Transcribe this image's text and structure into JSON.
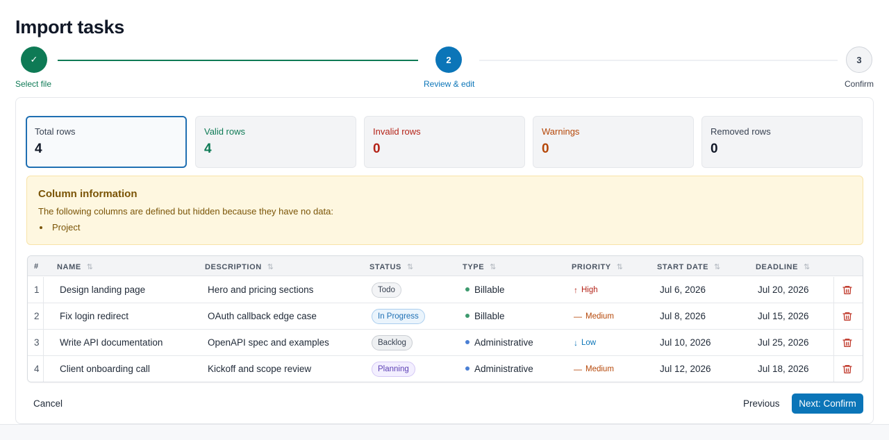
{
  "page": {
    "title": "Import tasks"
  },
  "stepper": {
    "steps": [
      {
        "marker": "✓",
        "label": "Select file",
        "state": "done"
      },
      {
        "marker": "2",
        "label": "Review & edit",
        "state": "active"
      },
      {
        "marker": "3",
        "label": "Confirm",
        "state": "todo"
      }
    ]
  },
  "stats": [
    {
      "label": "Total rows",
      "value": "4"
    },
    {
      "label": "Valid rows",
      "value": "4"
    },
    {
      "label": "Invalid rows",
      "value": "0"
    },
    {
      "label": "Warnings",
      "value": "0"
    },
    {
      "label": "Removed rows",
      "value": "0"
    }
  ],
  "info": {
    "title": "Column information",
    "text": "The following columns are defined but hidden because they have no data:",
    "items": [
      "Project"
    ]
  },
  "table": {
    "headers": {
      "num": "#",
      "name": "NAME",
      "description": "DESCRIPTION",
      "status": "STATUS",
      "type": "TYPE",
      "priority": "PRIORITY",
      "start_date": "START DATE",
      "deadline": "DEADLINE"
    },
    "sort_glyph": "⇅",
    "rows": [
      {
        "num": "1",
        "name": "Design landing page",
        "description": "Hero and pricing sections",
        "status": "Todo",
        "type": "Billable",
        "priority": "High",
        "priority_icon": "↑",
        "start_date": "Jul 6, 2026",
        "deadline": "Jul 20, 2026"
      },
      {
        "num": "2",
        "name": "Fix login redirect",
        "description": "OAuth callback edge case",
        "status": "In Progress",
        "type": "Billable",
        "priority": "Medium",
        "priority_icon": "—",
        "start_date": "Jul 8, 2026",
        "deadline": "Jul 15, 2026"
      },
      {
        "num": "3",
        "name": "Write API documentation",
        "description": "OpenAPI spec and examples",
        "status": "Backlog",
        "type": "Administrative",
        "priority": "Low",
        "priority_icon": "↓",
        "start_date": "Jul 10, 2026",
        "deadline": "Jul 25, 2026"
      },
      {
        "num": "4",
        "name": "Client onboarding call",
        "description": "Kickoff and scope review",
        "status": "Planning",
        "type": "Administrative",
        "priority": "Medium",
        "priority_icon": "—",
        "start_date": "Jul 12, 2026",
        "deadline": "Jul 18, 2026"
      }
    ]
  },
  "footer": {
    "cancel": "Cancel",
    "previous": "Previous",
    "next": "Next: Confirm"
  },
  "colors": {
    "primary": "#0b75b8",
    "success": "#0e7a55",
    "danger": "#b42318",
    "warning": "#b54708",
    "billable_dot": "#3d9a6e",
    "administrative_dot": "#4a7fd4",
    "trash": "#c0392b"
  },
  "icons": {
    "step_done": "check-icon",
    "delete": "trash-icon",
    "sort": "sort-icon"
  }
}
